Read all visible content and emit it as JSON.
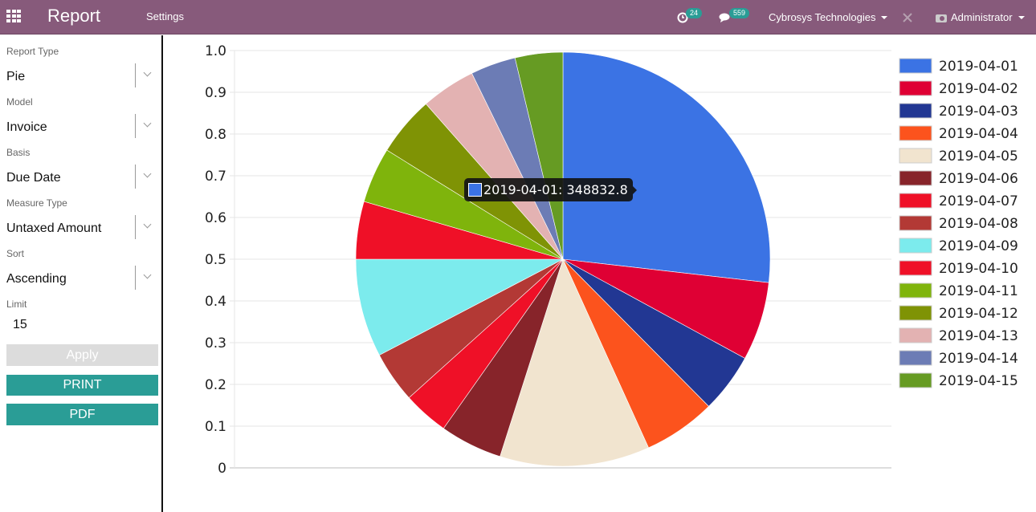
{
  "topbar": {
    "app_title": "Report",
    "menu_settings": "Settings",
    "activity_count": "24",
    "message_count": "559",
    "company": "Cybrosys Technologies",
    "user": "Administrator",
    "bg_color": "#875a7b"
  },
  "sidebar": {
    "fields": [
      {
        "label": "Report Type",
        "value": "Pie"
      },
      {
        "label": "Model",
        "value": "Invoice"
      },
      {
        "label": "Basis",
        "value": "Due Date"
      },
      {
        "label": "Measure Type",
        "value": "Untaxed Amount"
      },
      {
        "label": "Sort",
        "value": "Ascending"
      }
    ],
    "limit_label": "Limit",
    "limit_value": "15",
    "apply_label": "Apply",
    "print_label": "PRINT",
    "pdf_label": "PDF"
  },
  "tooltip": {
    "label": "2019-04-01: 348832.8",
    "color": "#3b73e4"
  },
  "chart_data": {
    "type": "pie",
    "title": "",
    "y_axis_ticks": [
      "0",
      "0.1",
      "0.2",
      "0.3",
      "0.4",
      "0.5",
      "0.6",
      "0.7",
      "0.8",
      "0.9",
      "1.0"
    ],
    "ylim": [
      0,
      1
    ],
    "grid": true,
    "legend_position": "right",
    "categories": [
      "2019-04-01",
      "2019-04-02",
      "2019-04-03",
      "2019-04-04",
      "2019-04-05",
      "2019-04-06",
      "2019-04-07",
      "2019-04-08",
      "2019-04-09",
      "2019-04-10",
      "2019-04-11",
      "2019-04-12",
      "2019-04-13",
      "2019-04-14",
      "2019-04-15"
    ],
    "values": [
      348832.8,
      79889,
      60368,
      73382,
      152186,
      63260,
      46270,
      52054,
      99770,
      58561,
      56392,
      60730,
      55307,
      45909,
      48439
    ],
    "colors": [
      "#3b73e4",
      "#df0034",
      "#223793",
      "#fc531d",
      "#f1e4cf",
      "#87242a",
      "#ef1027",
      "#b33935",
      "#7cebed",
      "#ef1027",
      "#7fb40c",
      "#7f9305",
      "#e3b2b2",
      "#6c7cb5",
      "#669b23"
    ]
  }
}
